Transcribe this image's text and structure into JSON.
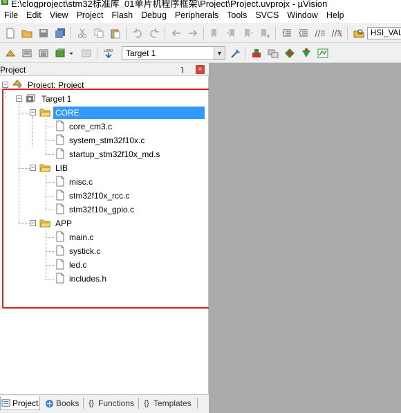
{
  "window": {
    "title": "E:\\clogproject\\stm32标准库_01单片机程序框架\\Project\\Project.uvprojx - µVision"
  },
  "menu": [
    "File",
    "Edit",
    "View",
    "Project",
    "Flash",
    "Debug",
    "Peripherals",
    "Tools",
    "SVCS",
    "Window",
    "Help"
  ],
  "toolbar": {
    "hsi_value": "HSI_VALUE",
    "target_select": "Target 1"
  },
  "panel": {
    "title": "Project",
    "pin": "ɿ",
    "close": "×"
  },
  "tree": {
    "root": "Project: Project",
    "target": "Target 1",
    "groups": [
      {
        "name": "CORE",
        "files": [
          "core_cm3.c",
          "system_stm32f10x.c",
          "startup_stm32f10x_md.s"
        ]
      },
      {
        "name": "LIB",
        "files": [
          "misc.c",
          "stm32f10x_rcc.c",
          "stm32f10x_gpio.c"
        ]
      },
      {
        "name": "APP",
        "files": [
          "main.c",
          "systick.c",
          "led.c",
          "includes.h"
        ]
      }
    ],
    "selected": "CORE"
  },
  "bottom_tabs": [
    {
      "label": "Project",
      "icon": "project-icon",
      "active": true
    },
    {
      "label": "Books",
      "icon": "books-icon",
      "active": false
    },
    {
      "label": "Functions",
      "icon": "braces-icon",
      "active": false
    },
    {
      "label": "Templates",
      "icon": "templates-icon",
      "active": false
    }
  ],
  "colors": {
    "selection": "#3399ff",
    "highlight_border": "#e0221b",
    "editor_background": "#ababab"
  }
}
